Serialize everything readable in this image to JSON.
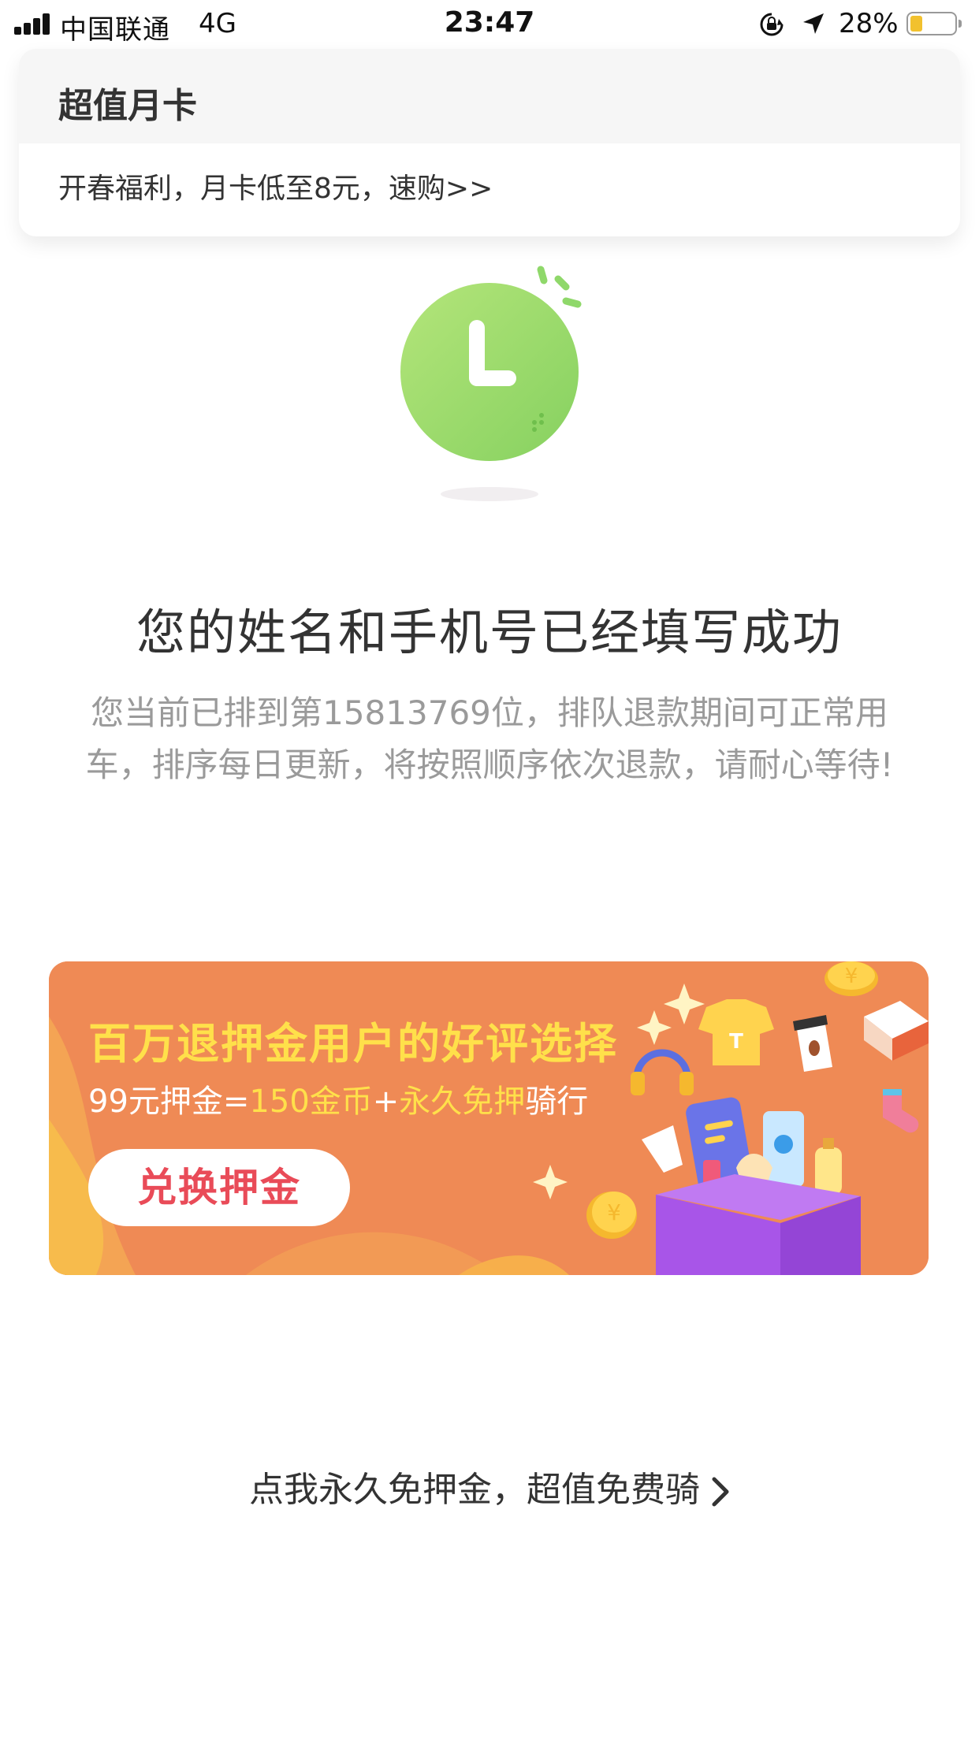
{
  "status_bar": {
    "carrier": "中国联通",
    "network": "4G",
    "time": "23:47",
    "battery_percent": "28%",
    "battery_level": 0.28,
    "icons": [
      "signal-icon",
      "orientation-lock-icon",
      "location-arrow-icon",
      "battery-icon"
    ]
  },
  "month_card": {
    "title": "超值月卡",
    "promo": "开春福利，月卡低至8元，速购>>"
  },
  "success": {
    "title": "您的姓名和手机号已经填写成功",
    "description": "您当前已排到第15813769位，排队退款期间可正常用车，排序每日更新，将按照顺序依次退款，请耐心等待!"
  },
  "banner": {
    "title": "百万退押金用户的好评选择",
    "subtitle_parts": {
      "p1": "99元押金=",
      "p2": "150金币",
      "p3": "+",
      "p4": "永久免押",
      "p5": "骑行"
    },
    "button_label": "兑换押金",
    "coin_symbol": "¥",
    "shirt_letter": "T"
  },
  "bottom_link": {
    "label": "点我永久免押金，超值免费骑"
  },
  "colors": {
    "clock_green": "#8fd86a",
    "banner_orange": "#ef8a55",
    "banner_yellow": "#ffe04a",
    "button_red": "#e94b58",
    "gift_purple": "#a855e8"
  }
}
